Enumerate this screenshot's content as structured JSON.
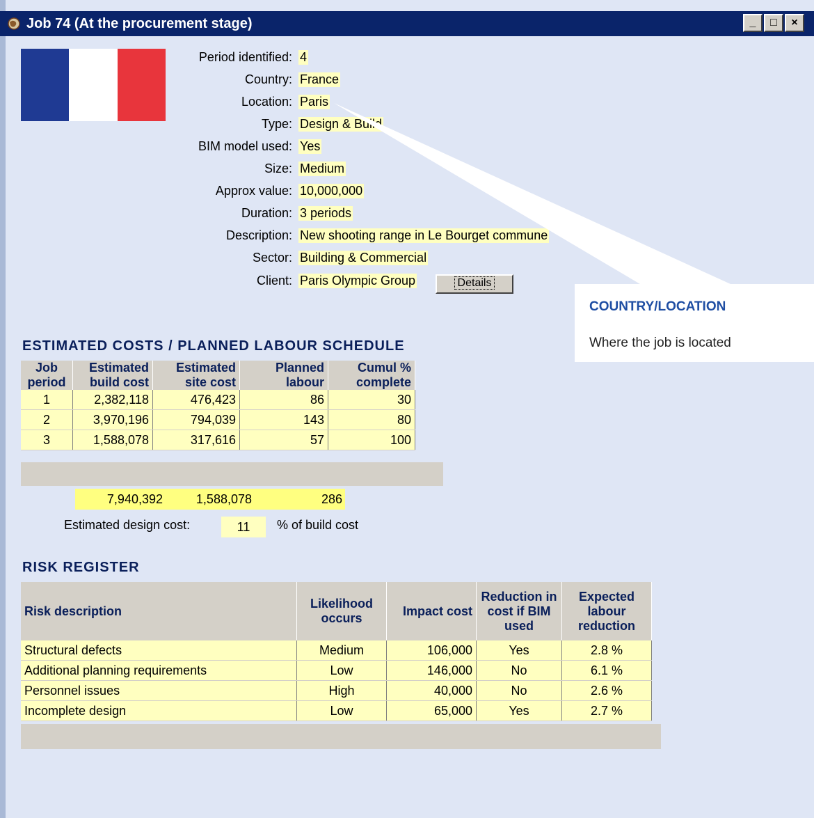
{
  "window": {
    "title": "Job 74  (At the procurement stage)",
    "minimize": "_",
    "maximize": "□",
    "close": "×"
  },
  "colors": {
    "flag_blue": "#1f3a93",
    "flag_white": "#ffffff",
    "flag_red": "#e8353c"
  },
  "info": {
    "period_label": "Period identified:",
    "period": "4",
    "country_label": "Country:",
    "country": "France",
    "location_label": "Location:",
    "location": "Paris",
    "type_label": "Type:",
    "type": "Design & Build",
    "bim_label": "BIM model used:",
    "bim": "Yes",
    "size_label": "Size:",
    "size": "Medium",
    "value_label": "Approx value:",
    "value": "10,000,000",
    "duration_label": "Duration:",
    "duration": "3 periods",
    "description_label": "Description:",
    "description": "New shooting range in Le Bourget commune",
    "sector_label": "Sector:",
    "sector": "Building & Commercial",
    "client_label": "Client:",
    "client": "Paris Olympic Group",
    "details_button": "Details"
  },
  "callout": {
    "heading": "COUNTRY/LOCATION",
    "body": "Where the job is located"
  },
  "costs": {
    "heading": "ESTIMATED COSTS / PLANNED LABOUR SCHEDULE",
    "headers": [
      [
        "Job",
        "period"
      ],
      [
        "Estimated",
        "build cost"
      ],
      [
        "Estimated",
        "site cost"
      ],
      [
        "Planned",
        "labour"
      ],
      [
        "Cumul %",
        "complete"
      ]
    ],
    "rows": [
      [
        "1",
        "2,382,118",
        "476,423",
        "86",
        "30"
      ],
      [
        "2",
        "3,970,196",
        "794,039",
        "143",
        "80"
      ],
      [
        "3",
        "1,588,078",
        "317,616",
        "57",
        "100"
      ]
    ],
    "totals": {
      "build": "7,940,392",
      "site": "1,588,078",
      "labour": "286"
    },
    "design_label": "Estimated design cost:",
    "design_value": "11",
    "design_unit": "% of build cost"
  },
  "risk": {
    "heading": "RISK REGISTER",
    "headers": [
      "Risk description",
      "Likelihood occurs",
      "Impact cost",
      "Reduction in cost if BIM used",
      "Expected labour reduction"
    ],
    "rows": [
      [
        "Structural defects",
        "Medium",
        "106,000",
        "Yes",
        "2.8 %"
      ],
      [
        "Additional planning requirements",
        "Low",
        "146,000",
        "No",
        "6.1 %"
      ],
      [
        "Personnel issues",
        "High",
        "40,000",
        "No",
        "2.6 %"
      ],
      [
        "Incomplete design",
        "Low",
        "65,000",
        "Yes",
        "2.7 %"
      ]
    ]
  }
}
